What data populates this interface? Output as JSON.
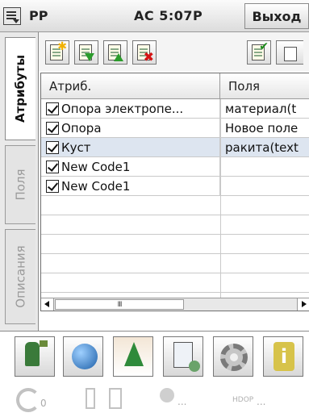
{
  "titlebar": {
    "app_name": "PP",
    "status": "AC  5:07P",
    "exit_label": "Выход"
  },
  "tabs": [
    {
      "label": "Атрибуты",
      "active": true
    },
    {
      "label": "Поля",
      "active": false
    },
    {
      "label": "Описания",
      "active": false
    }
  ],
  "toolbar": {
    "buttons": [
      "new-item-icon",
      "import-icon",
      "export-icon",
      "delete-icon",
      "check-icon",
      "copy-icon"
    ]
  },
  "grid": {
    "columns": [
      "Атриб.",
      "Поля"
    ],
    "rows": [
      {
        "attr": "Опора электропе...",
        "field": "материал(t",
        "checked": true,
        "selected": false
      },
      {
        "attr": "Опора",
        "field": "Новое поле",
        "checked": true,
        "selected": false
      },
      {
        "attr": "Куст",
        "field": "ракита(text",
        "checked": true,
        "selected": true
      },
      {
        "attr": "New Code1",
        "field": "",
        "checked": true,
        "selected": false
      },
      {
        "attr": "New Code1",
        "field": "",
        "checked": true,
        "selected": false
      }
    ],
    "scroll_thumb": "III"
  },
  "statusbar": {
    "satellites": "0",
    "conn_dots": "...",
    "hdop_label": "HDOP",
    "hdop_dots": "..."
  }
}
